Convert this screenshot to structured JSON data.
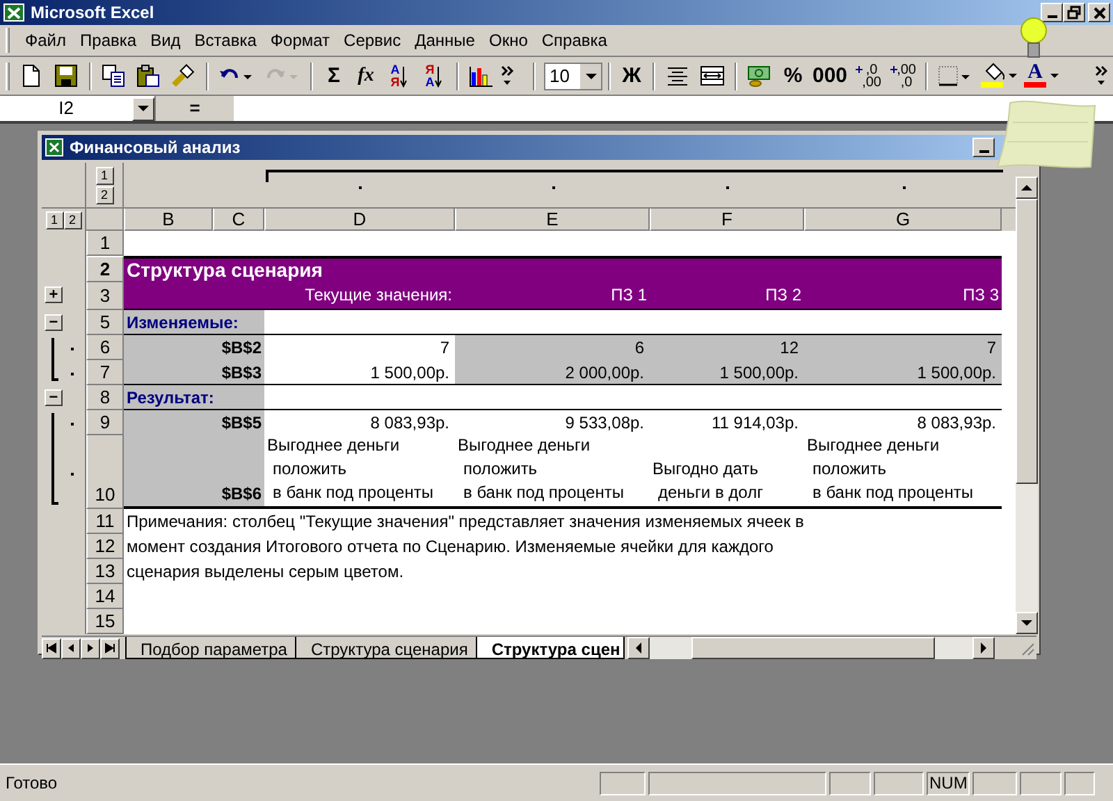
{
  "app_title": "Microsoft Excel",
  "menu": [
    "Файл",
    "Правка",
    "Вид",
    "Вставка",
    "Формат",
    "Сервис",
    "Данные",
    "Окно",
    "Справка"
  ],
  "toolbar": [
    {
      "kind": "new",
      "disabled": false
    },
    {
      "kind": "save",
      "disabled": false
    },
    {
      "kind": "separator"
    },
    {
      "kind": "copy",
      "disabled": false
    },
    {
      "kind": "paste",
      "disabled": false
    },
    {
      "kind": "painter",
      "disabled": false
    },
    {
      "kind": "separator"
    },
    {
      "kind": "undo",
      "disabled": false
    },
    {
      "kind": "redo",
      "disabled": true
    },
    {
      "kind": "separator"
    },
    {
      "kind": "text",
      "text": "Σ",
      "disabled": false
    },
    {
      "kind": "italic",
      "text": "fx",
      "disabled": false
    },
    {
      "kind": "sort",
      "top": "А",
      "bottom": "Я",
      "descending": false,
      "disabled": false
    },
    {
      "kind": "sort",
      "top": "Я",
      "bottom": "А",
      "descending": true,
      "disabled": false
    },
    {
      "kind": "separator"
    },
    {
      "kind": "chart",
      "disabled": false
    },
    {
      "kind": "more",
      "disabled": false
    },
    {
      "kind": "separator"
    },
    {
      "kind": "combo",
      "value": "10",
      "disabled": false
    },
    {
      "kind": "separator"
    },
    {
      "kind": "text",
      "text": "Ж",
      "disabled": false
    },
    {
      "kind": "separator"
    },
    {
      "kind": "align",
      "disabled": false
    },
    {
      "kind": "merge",
      "disabled": false
    },
    {
      "kind": "separator"
    },
    {
      "kind": "currency",
      "disabled": false
    },
    {
      "kind": "text",
      "text": "%",
      "disabled": false
    },
    {
      "kind": "text",
      "text": "000",
      "disabled": false
    },
    {
      "kind": "decimal",
      "top": ",0",
      "bottom": ",00",
      "disabled": false
    },
    {
      "kind": "decimal",
      "top": ",00",
      "bottom": ",0",
      "disabled": false
    },
    {
      "kind": "separator"
    },
    {
      "kind": "borders",
      "disabled": false
    },
    {
      "kind": "fill",
      "color": "#ffff00",
      "disabled": false
    },
    {
      "kind": "font_color",
      "text": "A",
      "color": "#ff0000",
      "disabled": false
    }
  ],
  "formula_bar": {
    "name_box": "I2",
    "equals": "="
  },
  "workbook": {
    "title": "Финансовый анализ",
    "column_levels": [
      "1",
      "2"
    ],
    "row_levels": [
      "1",
      "2"
    ],
    "columns": [
      "B",
      "C",
      "D",
      "E",
      "F",
      "G"
    ],
    "rows": [
      {
        "number": "1",
        "selected": false,
        "kind": "blank"
      },
      {
        "number": "2",
        "selected": true,
        "kind": "title",
        "label": "Структура сценария"
      },
      {
        "number": "3",
        "selected": false,
        "kind": "header",
        "outline": {
          "kind": "button",
          "symbol": "+"
        },
        "values": [
          "Текущие значения:",
          "ПЗ 1",
          "ПЗ 2",
          "ПЗ 3"
        ]
      },
      {
        "number": "5",
        "selected": false,
        "kind": "section",
        "outline": {
          "kind": "button",
          "symbol": "−"
        },
        "label": "Изменяемые:"
      },
      {
        "number": "6",
        "selected": false,
        "kind": "data",
        "outline": {
          "kind": "detail"
        },
        "label": "$B$2",
        "values": [
          {
            "text": "7",
            "shaded": false
          },
          {
            "text": "6",
            "shaded": true
          },
          {
            "text": "12",
            "shaded": true
          },
          {
            "text": "7",
            "shaded": true
          }
        ]
      },
      {
        "number": "7",
        "selected": false,
        "kind": "data",
        "outline": {
          "kind": "detail"
        },
        "label": "$B$3",
        "values": [
          {
            "text": "1 500,00р.",
            "shaded": false
          },
          {
            "text": "2 000,00р.",
            "shaded": true
          },
          {
            "text": "1 500,00р.",
            "shaded": true
          },
          {
            "text": "1 500,00р.",
            "shaded": true
          }
        ]
      },
      {
        "number": "8",
        "selected": false,
        "kind": "section",
        "outline": {
          "kind": "button",
          "symbol": "−"
        },
        "label": "Результат:"
      },
      {
        "number": "9",
        "selected": false,
        "kind": "data",
        "outline": {
          "kind": "detail"
        },
        "label": "$B$5",
        "values": [
          {
            "text": "8 083,93р.",
            "shaded": false
          },
          {
            "text": "9 533,08р.",
            "shaded": false
          },
          {
            "text": "11 914,03р.",
            "shaded": false
          },
          {
            "text": "8 083,93р.",
            "shaded": false
          }
        ]
      },
      {
        "number": "10",
        "selected": false,
        "kind": "data",
        "outline": {
          "kind": "detail"
        },
        "label": "$B$6",
        "values": [
          {
            "lines": [
              "Выгоднее деньги",
              "положить",
              "в банк под проценты"
            ],
            "shaded": false
          },
          {
            "lines": [
              "Выгоднее деньги",
              "положить",
              "в банк под проценты"
            ],
            "shaded": false
          },
          {
            "lines": [
              "Выгодно дать",
              "деньги в долг"
            ],
            "shaded": false
          },
          {
            "lines": [
              "Выгоднее деньги",
              "положить",
              "в банк под проценты"
            ],
            "shaded": false
          }
        ]
      },
      {
        "number": "11",
        "selected": false,
        "kind": "note",
        "text": "Примечания: столбец \"Текущие значения\" представляет значения изменяемых ячеек в"
      },
      {
        "number": "12",
        "selected": false,
        "kind": "note",
        "text": "момент создания Итогового отчета по Сценарию. Изменяемые ячейки для каждого"
      },
      {
        "number": "13",
        "selected": false,
        "kind": "note",
        "text": "сценария выделены серым цветом."
      },
      {
        "number": "14",
        "selected": false,
        "kind": "blank"
      },
      {
        "number": "15",
        "selected": false,
        "kind": "blank"
      }
    ],
    "sheet_tabs": [
      {
        "label": "Подбор параметра",
        "selected": false
      },
      {
        "label": "Структура сценария",
        "selected": false
      },
      {
        "label": "Структура сцен",
        "selected": true
      }
    ]
  },
  "status_bar": {
    "text": "Готово",
    "indicator": "NUM"
  }
}
